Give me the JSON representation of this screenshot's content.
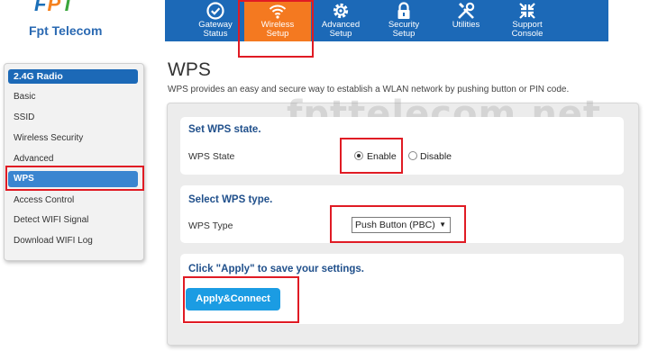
{
  "brand": {
    "logo_letters": [
      "F",
      "P",
      "T"
    ],
    "name": "Fpt Telecom"
  },
  "nav": {
    "items": [
      {
        "line1": "Gateway",
        "line2": "Status",
        "icon": "check-circle-icon",
        "active": false
      },
      {
        "line1": "Wireless",
        "line2": "Setup",
        "icon": "wifi-icon",
        "active": true
      },
      {
        "line1": "Advanced",
        "line2": "Setup",
        "icon": "gear-icon",
        "active": false
      },
      {
        "line1": "Security",
        "line2": "Setup",
        "icon": "lock-icon",
        "active": false
      },
      {
        "line1": "Utilities",
        "line2": "",
        "icon": "tools-icon",
        "active": false
      },
      {
        "line1": "Support",
        "line2": "Console",
        "icon": "support-arrows-icon",
        "active": false
      }
    ]
  },
  "sidebar": {
    "header": "2.4G Radio",
    "items": [
      {
        "label": "Basic"
      },
      {
        "label": "SSID"
      },
      {
        "label": "Wireless Security"
      },
      {
        "label": "Advanced"
      },
      {
        "label": "WPS"
      },
      {
        "label": "Access Control"
      },
      {
        "label": "Detect WIFI Signal"
      },
      {
        "label": "Download WIFI Log"
      }
    ],
    "active_label": "WPS"
  },
  "page": {
    "title": "WPS",
    "description": "WPS provides an easy and secure way to establish a WLAN network by pushing button or PIN code.",
    "watermark": "fpttelecom.net"
  },
  "wps_state": {
    "section_title": "Set WPS state.",
    "label": "WPS State",
    "options": [
      {
        "label": "Enable",
        "selected": true
      },
      {
        "label": "Disable",
        "selected": false
      }
    ]
  },
  "wps_type": {
    "section_title": "Select WPS type.",
    "label": "WPS Type",
    "selected": "Push Button (PBC)"
  },
  "apply": {
    "note": "Click \"Apply\" to save your settings.",
    "button_label": "Apply&Connect"
  },
  "colors": {
    "nav_bg": "#1c69b7",
    "nav_active": "#f47920",
    "highlight": "#e01b24",
    "button": "#1b9ce3",
    "section_title": "#1f4f8b"
  }
}
